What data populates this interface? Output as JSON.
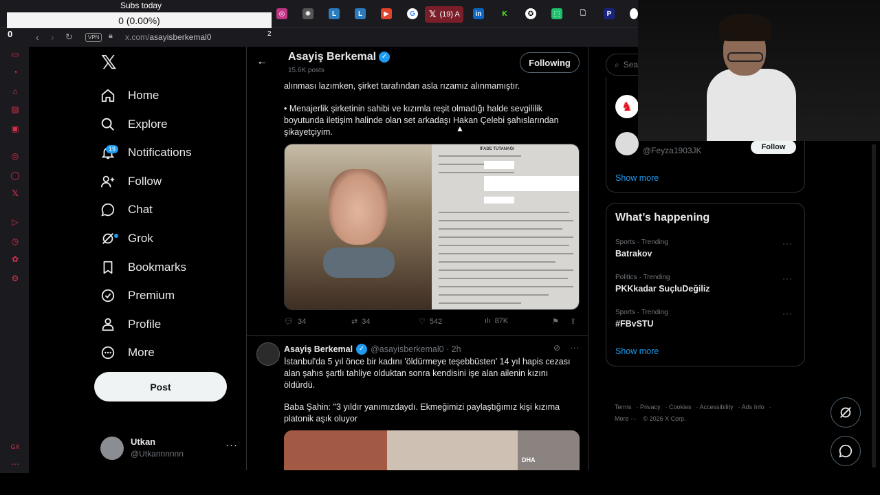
{
  "browser": {
    "url_prefix": "x.com/",
    "url_path": "asayisberkemal0",
    "vpn_label": "VPN",
    "active_tab_badge": "(19) A",
    "tab_letters": [
      "L",
      "L",
      "in",
      "K",
      "P"
    ]
  },
  "overlay": {
    "subs_title": "Subs today",
    "subs_value": "0 (0.00%)",
    "left_count": "0",
    "right_count": "2"
  },
  "nav": {
    "items": [
      {
        "label": "Home",
        "icon": "home-icon"
      },
      {
        "label": "Explore",
        "icon": "search-icon"
      },
      {
        "label": "Notifications",
        "icon": "bell-icon",
        "badge": "19"
      },
      {
        "label": "Follow",
        "icon": "person-add-icon"
      },
      {
        "label": "Chat",
        "icon": "chat-icon"
      },
      {
        "label": "Grok",
        "icon": "grok-icon"
      },
      {
        "label": "Bookmarks",
        "icon": "bookmark-icon"
      },
      {
        "label": "Premium",
        "icon": "verified-icon"
      },
      {
        "label": "Profile",
        "icon": "person-icon"
      },
      {
        "label": "More",
        "icon": "more-circle-icon"
      }
    ],
    "post_label": "Post",
    "account": {
      "name": "Utkan",
      "handle": "@Utkannnnnn",
      "more": "···"
    }
  },
  "profile_header": {
    "name": "Asayiş Berkemal",
    "posts": "15.6K posts",
    "follow_label": "Following"
  },
  "tweet1": {
    "text_top": "alınması lazımken, şirket tarafından asla rızamız alınmamıştır.",
    "text_bullet": "• Menajerlik şirketinin sahibi ve kızımla reşit olmadığı halde sevgililik boyutunda iletişim halinde olan set arkadaşı Hakan Çelebi şahıslarından şikayetçiyim.",
    "doc_header": "İFADE TUTANAĞI",
    "replies": "34",
    "reposts": "34",
    "likes": "542",
    "views": "87K"
  },
  "tweet2": {
    "name": "Asayiş Berkemal",
    "handle": "@asayisberkemal0 · 2h",
    "text1": "İstanbul'da 5 yıl önce bir kadını 'öldürmeye teşebbüsten' 14 yıl hapis cezası alan şahıs şartlı tahliye olduktan sonra kendisini işe alan ailenin kızını öldürdü.",
    "text2": "Baba Şahin: \"3 yıldır yanımızdaydı. Ekmeğimizi paylaştığımız kişi kızıma platonik aşık oluyor",
    "media_tag": "DHA"
  },
  "right": {
    "search_placeholder": "Sea",
    "who_to_follow": {
      "handle": "@Feyza1903JK",
      "follow_label": "Follow",
      "show_more": "Show more"
    },
    "whats_happening": {
      "title": "What’s happening",
      "trends": [
        {
          "meta": "Sports · Trending",
          "topic": "Batrakov"
        },
        {
          "meta": "Politics · Trending",
          "topic": "PKKkadar SuçluDeğiliz"
        },
        {
          "meta": "Sports · Trending",
          "topic": "#FBvSTU"
        }
      ],
      "show_more": "Show more"
    },
    "footer": {
      "links": [
        "Terms",
        "Privacy",
        "Cookies",
        "Accessibility",
        "Ads Info"
      ],
      "more": "More ···",
      "copyright": "© 2026 X Corp."
    }
  },
  "colors": {
    "accent": "#1d9bf0",
    "background": "#000000",
    "border": "#2f3336",
    "muted": "#71767b",
    "browser_tab_active": "#7a1f2a"
  }
}
